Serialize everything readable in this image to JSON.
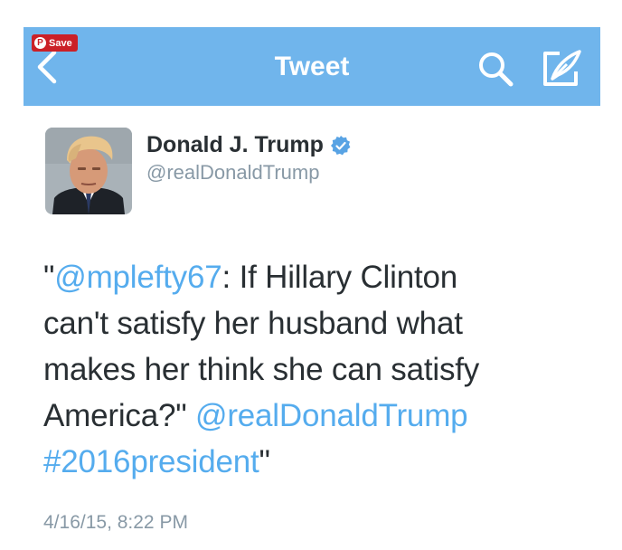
{
  "header": {
    "title": "Tweet",
    "save_badge": "Save",
    "pin_glyph": "P",
    "background": "#70b5ec",
    "icons": [
      "back-arrow-icon",
      "search-icon",
      "compose-icon"
    ]
  },
  "author": {
    "name": "Donald J. Trump",
    "handle": "@realDonaldTrump",
    "verified": true
  },
  "tweet": {
    "lines": [
      [
        {
          "text": "\"",
          "link": false
        },
        {
          "text": "@mplefty67",
          "link": true
        },
        {
          "text": ":  If Hillary Clinton",
          "link": false
        }
      ],
      [
        {
          "text": "can't satisfy her husband what",
          "link": false
        }
      ],
      [
        {
          "text": "makes her think she can satisfy",
          "link": false
        }
      ],
      [
        {
          "text": "America?\" ",
          "link": false
        },
        {
          "text": "@realDonaldTrump",
          "link": true
        }
      ],
      [
        {
          "text": "#2016president",
          "link": true
        },
        {
          "text": "\"",
          "link": false
        }
      ]
    ],
    "timestamp": "4/16/15, 8:22 PM"
  },
  "colors": {
    "link": "#55acee",
    "text": "#292f33",
    "muted": "#8899a6",
    "pinterest": "#cb2027"
  }
}
